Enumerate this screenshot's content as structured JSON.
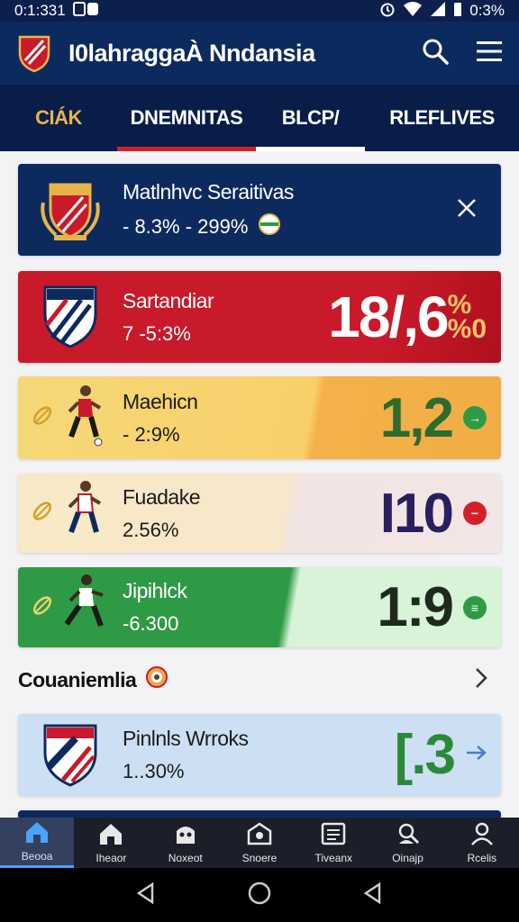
{
  "status": {
    "time": "0:1:331",
    "battery": "0:3%"
  },
  "app": {
    "title": "I0lahraggaÀ Nndansia"
  },
  "tabs": [
    {
      "label": "CIÁK"
    },
    {
      "label": "DNEMNITAS"
    },
    {
      "label": "BLCP/"
    },
    {
      "label": "RLEFLIVES"
    }
  ],
  "cards": [
    {
      "name": "Matlnhvc Seraitivas",
      "pct": "- 8.3% - 299%"
    },
    {
      "name": "Sartandiar",
      "pct": "7 -5:3%",
      "score_main": "18/,6",
      "score_suffix": "%\n%0"
    },
    {
      "name": "Maehicn",
      "pct": "- 2:9%",
      "score": "1,2"
    },
    {
      "name": "Fuadake",
      "pct": "2.56%",
      "score": "I10"
    },
    {
      "name": "Jipihlck",
      "pct": "-6.300",
      "score": "1:9"
    },
    {
      "name": "Pinlnls Wrroks",
      "pct": "1..30%",
      "score": "[.3"
    }
  ],
  "section": {
    "label": "Couaniemlia"
  },
  "nav": [
    {
      "label": "Beooa",
      "icon": "home-icon"
    },
    {
      "label": "Iheaor",
      "icon": "house-icon"
    },
    {
      "label": "Noxeot",
      "icon": "robot-icon"
    },
    {
      "label": "Snoere",
      "icon": "badge-icon"
    },
    {
      "label": "Tiveanx",
      "icon": "list-icon"
    },
    {
      "label": "Oinajp",
      "icon": "search-people-icon"
    },
    {
      "label": "Rcelis",
      "icon": "person-icon"
    }
  ],
  "colors": {
    "navy": "#0d2a5e",
    "red": "#c81a2a",
    "gold": "#e6b54a",
    "green": "#2f9a45"
  }
}
